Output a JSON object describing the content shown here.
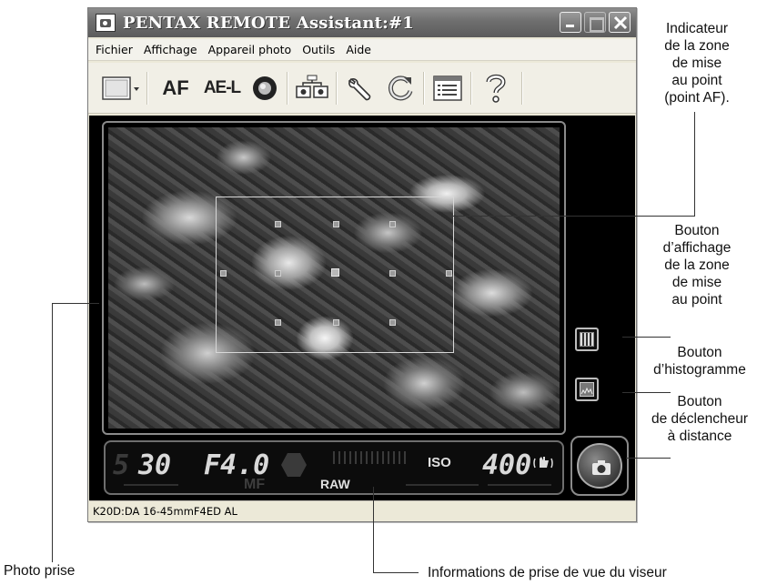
{
  "window": {
    "title": "PENTAX REMOTE Assistant:#1",
    "icon": "camera-app-icon",
    "controls": [
      "minimize-icon",
      "maximize-icon",
      "close-icon"
    ]
  },
  "menu": [
    "Fichier",
    "Affichage",
    "Appareil photo",
    "Outils",
    "Aide"
  ],
  "toolbar": {
    "af_label": "AF",
    "ael_label": "AE-L",
    "icons": [
      "display-mode-icon",
      "dropdown-arrow-icon",
      "circle-icon",
      "camera-network-icon",
      "wrench-icon",
      "refresh-icon",
      "list-window-icon",
      "help-icon"
    ]
  },
  "viewfinder": {
    "shutter_speed": "30",
    "aperture": "F4.0",
    "mf_label": "MF",
    "raw_label": "RAW",
    "iso_label": "ISO",
    "iso_value": "400"
  },
  "statusbar": {
    "text": "K20D:DA 16-45mmF4ED AL"
  },
  "callouts": {
    "af_indicator": [
      "Indicateur",
      "de la zone",
      "de mise",
      "au point",
      "(point AF)."
    ],
    "focus_button": [
      "Bouton",
      "d’affichage",
      "de la zone",
      "de mise",
      "au point"
    ],
    "histogram_button": [
      "Bouton",
      "d’histogramme"
    ],
    "shutter_button": [
      "Bouton",
      "de déclencheur",
      "à distance"
    ],
    "photo": "Photo prise",
    "viewfinder_info": "Informations de prise de vue du viseur"
  },
  "colors": {
    "titlebar": "#6e6e6e",
    "window_bg": "#ece9d8",
    "viewer_bg": "#000000"
  }
}
